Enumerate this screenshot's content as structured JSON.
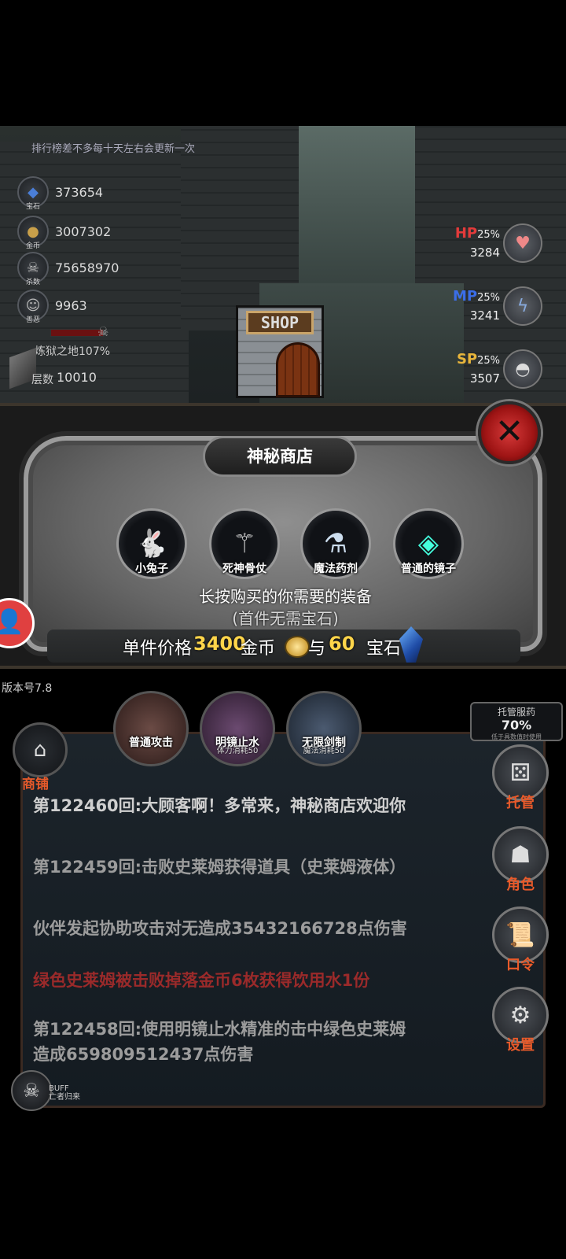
{
  "scene": {
    "rank_note": "排行榜差不多每十天左右会更新一次",
    "stats": [
      {
        "icon": "gem-icon",
        "label": "宝石",
        "value": "373654"
      },
      {
        "icon": "coin-icon",
        "label": "金币",
        "value": "3007302"
      },
      {
        "icon": "skull-icon",
        "label": "杀数",
        "value": "75658970"
      },
      {
        "icon": "mask-icon",
        "label": "善恶",
        "value": "9963"
      }
    ],
    "zone": "炼狱之地107%",
    "floor_label": "层数",
    "floor_value": "10010",
    "resources": [
      {
        "label": "HP",
        "pct": "25%",
        "value": "3284",
        "color": "#e33b3b",
        "icon": "potion-heart-icon"
      },
      {
        "label": "MP",
        "pct": "25%",
        "value": "3241",
        "color": "#3b6ee8",
        "icon": "potion-bolt-icon"
      },
      {
        "label": "SP",
        "pct": "25%",
        "value": "3507",
        "color": "#e8b53b",
        "icon": "food-plate-icon"
      }
    ],
    "shop_sign": "SHOP"
  },
  "dialog": {
    "title": "神秘商店",
    "items": [
      {
        "label": "小兔子",
        "icon": "rabbit-icon"
      },
      {
        "label": "死神骨仗",
        "icon": "bone-staff-icon"
      },
      {
        "label": "魔法药剂",
        "icon": "potion-icon"
      },
      {
        "label": "普通的镜子",
        "icon": "mirror-icon"
      }
    ],
    "hint": "长按购买的你需要的装备",
    "hint_sub": "(首件无需宝石)",
    "price_prefix": "单件价格",
    "price_gold": "3400",
    "gold_label": "金币",
    "and": "与",
    "price_gem": "60",
    "gem_label": "宝石"
  },
  "bottom": {
    "version": "版本号7.8",
    "skills": [
      {
        "name": "普通攻击",
        "sub": ""
      },
      {
        "name": "明镜止水",
        "sub": "体力消耗50"
      },
      {
        "name": "无限剑制",
        "sub": "魔法消耗50"
      }
    ],
    "shop_btn": "商铺",
    "auto_drug": {
      "title": "托管服药",
      "value": "70%",
      "note": "低于具数值时使用"
    },
    "log": [
      "第122460回:大顾客啊！多常来，神秘商店欢迎你",
      "第122459回:击败史莱姆获得道具（史莱姆液体）",
      "伙伴发起协助攻击对无造成35432166728点伤害",
      "绿色史莱姆被击败掉落金币6枚获得饮用水1份",
      "第122458回:使用明镜止水精准的击中绿色史莱姆",
      "造成659809512437点伤害"
    ],
    "side_buttons": [
      {
        "label": "托管",
        "icon": "dice-icon"
      },
      {
        "label": "角色",
        "icon": "hooded-figure-icon"
      },
      {
        "label": "口令",
        "icon": "scroll-icon"
      },
      {
        "label": "设置",
        "icon": "gear-icon"
      }
    ],
    "buff_label": "BUFF",
    "buff_text": "亡者归来"
  }
}
